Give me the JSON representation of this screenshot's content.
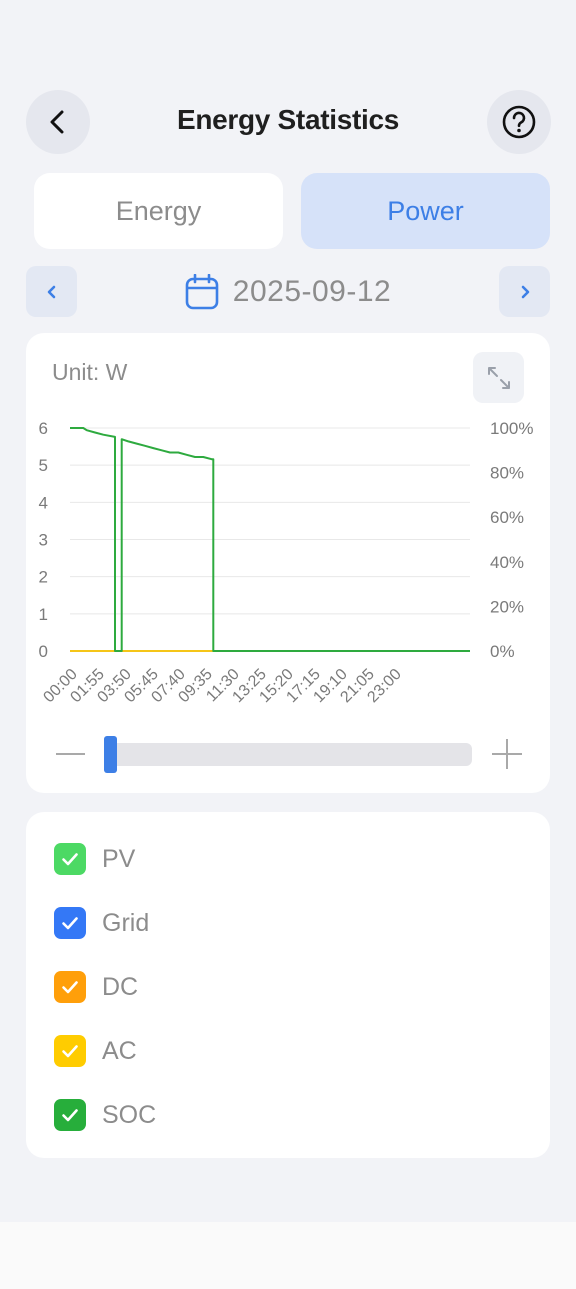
{
  "header": {
    "title": "Energy Statistics",
    "back_icon": "chevron-left-icon",
    "help_icon": "question-circle-icon"
  },
  "tabs": [
    {
      "label": "Energy",
      "selected": false
    },
    {
      "label": "Power",
      "selected": true
    }
  ],
  "date_nav": {
    "date": "2025-09-12",
    "prev_icon": "chevron-left-icon",
    "next_icon": "chevron-right-icon",
    "calendar_icon": "calendar-icon"
  },
  "chart_card": {
    "unit_label": "Unit: W",
    "expand_icon": "expand-icon"
  },
  "chart_data": {
    "type": "line",
    "title": "",
    "x_tick_labels": [
      "00:00",
      "01:55",
      "03:50",
      "05:45",
      "07:40",
      "09:35",
      "11:30",
      "13:25",
      "15:20",
      "17:15",
      "19:10",
      "21:05",
      "23:00"
    ],
    "y_left_ticks": [
      "0",
      "1",
      "2",
      "3",
      "4",
      "5",
      "6"
    ],
    "y_right_ticks": [
      "0%",
      "20%",
      "40%",
      "60%",
      "80%",
      "100%"
    ],
    "ylim_left": [
      0,
      6
    ],
    "ylim_right": [
      0,
      100
    ],
    "xlim_hours": [
      0,
      24
    ],
    "grid": true,
    "series": [
      {
        "name": "AC",
        "color": "#f5c518",
        "axis": "left",
        "points": [
          [
            0,
            0
          ],
          [
            24,
            0
          ]
        ]
      },
      {
        "name": "SOC",
        "color": "#2eaa3f",
        "axis": "right",
        "points": [
          [
            0,
            100
          ],
          [
            0.8,
            100
          ],
          [
            1.0,
            99
          ],
          [
            1.5,
            98
          ],
          [
            2.0,
            97
          ],
          [
            2.7,
            96
          ],
          [
            2.7,
            0
          ],
          [
            3.1,
            0
          ],
          [
            3.1,
            95
          ],
          [
            3.5,
            94
          ],
          [
            4.0,
            93
          ],
          [
            4.5,
            92
          ],
          [
            5.0,
            91
          ],
          [
            5.5,
            90
          ],
          [
            6.0,
            89
          ],
          [
            6.5,
            89
          ],
          [
            7.0,
            88
          ],
          [
            7.5,
            87
          ],
          [
            8.0,
            87
          ],
          [
            8.5,
            86
          ],
          [
            8.6,
            86
          ],
          [
            8.6,
            0
          ],
          [
            24,
            0
          ]
        ]
      }
    ]
  },
  "zoom_slider": {
    "minus_icon": "minus-icon",
    "plus_icon": "plus-icon",
    "thumb_position": 0.0
  },
  "legend": [
    {
      "label": "PV",
      "color": "#4cd964",
      "checked": true
    },
    {
      "label": "Grid",
      "color": "#3478f6",
      "checked": true
    },
    {
      "label": "DC",
      "color": "#ff9f0a",
      "checked": true
    },
    {
      "label": "AC",
      "color": "#ffcc00",
      "checked": true
    },
    {
      "label": "SOC",
      "color": "#27ae3b",
      "checked": true
    }
  ]
}
